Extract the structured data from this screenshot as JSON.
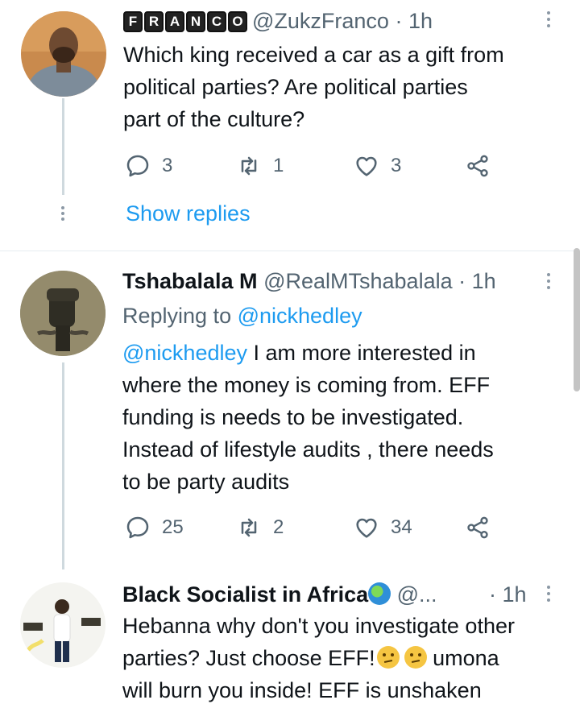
{
  "tweets": [
    {
      "display_name": "FRANCO",
      "badge_letters": [
        "F",
        "R",
        "A",
        "N",
        "C",
        "O"
      ],
      "handle": "@ZukzFranco",
      "separator": "·",
      "time": "1h",
      "lines": [
        "Which king received a car as a gift from",
        "political parties? Are political parties",
        "part of the culture?"
      ],
      "replies": "3",
      "retweets": "1",
      "likes": "3",
      "show_replies": "Show replies"
    },
    {
      "display_name": "Tshabalala M",
      "handle": "@RealMTshabalala",
      "separator": "·",
      "time": "1h",
      "replying_prefix": "Replying to ",
      "replying_to": "@nickhedley",
      "mention": "@nickhedley",
      "lines": [
        " I am more interested in",
        "where the money is coming from. EFF",
        "funding is needs to be investigated.",
        "Instead of lifestyle audits , there needs",
        "to be party audits"
      ],
      "replies": "25",
      "retweets": "2",
      "likes": "34"
    },
    {
      "display_name": "Black Socialist in Africa",
      "handle": "@...",
      "separator": "·",
      "time": "1h",
      "line1": "Hebanna why don't you investigate other",
      "line2_start": "parties? Just choose EFF!",
      "line2_end": " umona",
      "line3": "will burn you inside! EFF is unshaken"
    }
  ],
  "icons": {
    "reply": "reply-icon",
    "retweet": "retweet-icon",
    "like": "heart-icon",
    "share": "share-icon",
    "more": "more-icon",
    "globe": "globe-emoji",
    "confused": "confused-face-emoji"
  },
  "colors": {
    "link": "#1d9bf0",
    "secondary_text": "#536471",
    "thread_line": "#cfd9de"
  }
}
